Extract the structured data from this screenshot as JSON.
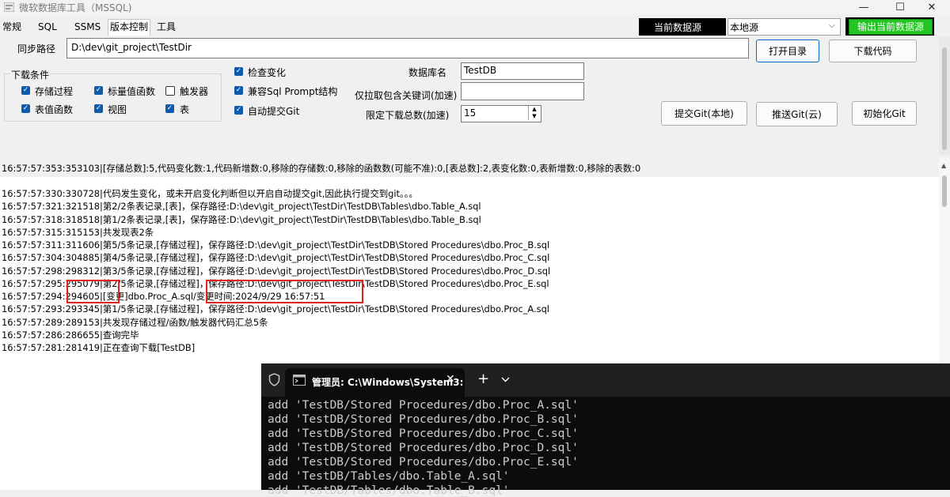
{
  "window": {
    "title": "微软数据库工具（MSSQL)",
    "minimize": "—",
    "maximize": "☐",
    "close": "✕"
  },
  "tabs": [
    "常规",
    "SQL",
    "SSMS",
    "版本控制",
    "工具"
  ],
  "datasource": {
    "label": "当前数据源",
    "selected": "本地源",
    "export_button": "输出当前数据源",
    "export_color": "#22c521"
  },
  "sync": {
    "path_label": "同步路径",
    "path_value": "D:\\dev\\git_project\\TestDir",
    "open_dir_button": "打开目录",
    "download_button": "下载代码"
  },
  "download_conditions": {
    "title": "下载条件",
    "items": [
      {
        "label": "存储过程",
        "checked": true
      },
      {
        "label": "标量值函数",
        "checked": true
      },
      {
        "label": "触发器",
        "checked": false
      },
      {
        "label": "表值函数",
        "checked": true
      },
      {
        "label": "视图",
        "checked": true
      },
      {
        "label": "表",
        "checked": true
      }
    ]
  },
  "options": [
    {
      "label": "检查变化",
      "checked": true
    },
    {
      "label": "兼容Sql Prompt结构",
      "checked": true
    },
    {
      "label": "自动提交Git",
      "checked": true
    }
  ],
  "db": {
    "name_label": "数据库名",
    "name_value": "TestDB",
    "keyword_label": "仅拉取包含关键词(加速)",
    "keyword_value": "",
    "limit_label": "限定下载总数(加速)",
    "limit_value": "15"
  },
  "git_buttons": {
    "commit_local": "提交Git(本地)",
    "push_cloud": "推送Git(云)",
    "init": "初始化Git"
  },
  "log": {
    "summary": "16:57:57:353:353103|[存储总数]:5,代码变化数:1,代码新增数:0,移除的存储数:0,移除的函数数(可能不准):0,[表总数]:2,表变化数:0,表新增数:0,移除的表数:0",
    "lines": [
      "16:57:57:330:330728|代码发生变化，或未开启变化判断但以开启自动提交git,因此执行提交到git。。。",
      "16:57:57:321:321518|第2/2条表记录,[表]，保存路径:D:\\dev\\git_project\\TestDir\\TestDB\\Tables\\dbo.Table_A.sql",
      "16:57:57:318:318518|第1/2条表记录,[表]，保存路径:D:\\dev\\git_project\\TestDir\\TestDB\\Tables\\dbo.Table_B.sql",
      "16:57:57:315:315153|共发现表2条",
      "16:57:57:311:311606|第5/5条记录,[存储过程]，保存路径:D:\\dev\\git_project\\TestDir\\TestDB\\Stored Procedures\\dbo.Proc_B.sql",
      "16:57:57:304:304885|第4/5条记录,[存储过程]，保存路径:D:\\dev\\git_project\\TestDir\\TestDB\\Stored Procedures\\dbo.Proc_C.sql",
      "16:57:57:298:298312|第3/5条记录,[存储过程]，保存路径:D:\\dev\\git_project\\TestDir\\TestDB\\Stored Procedures\\dbo.Proc_D.sql",
      "16:57:57:295:295079|第2/5条记录,[存储过程]，保存路径:D:\\dev\\git_project\\TestDir\\TestDB\\Stored Procedures\\dbo.Proc_E.sql",
      "16:57:57:294:294605|[变更]dbo.Proc_A.sql/变更时间:2024/9/29 16:57:51",
      "16:57:57:293:293345|第1/5条记录,[存储过程]，保存路径:D:\\dev\\git_project\\TestDir\\TestDB\\Stored Procedures\\dbo.Proc_A.sql",
      "16:57:57:289:289153|共发现存储过程/函数/触发器代码汇总5条",
      "16:57:57:286:286655|查询完毕",
      "16:57:57:281:281419|正在查询下载[TestDB]"
    ]
  },
  "terminal": {
    "tab_title": "管理员: C:\\Windows\\System3:",
    "new_tab": "+",
    "lines": [
      "add 'TestDB/Stored Procedures/dbo.Proc_A.sql'",
      "add 'TestDB/Stored Procedures/dbo.Proc_B.sql'",
      "add 'TestDB/Stored Procedures/dbo.Proc_C.sql'",
      "add 'TestDB/Stored Procedures/dbo.Proc_D.sql'",
      "add 'TestDB/Stored Procedures/dbo.Proc_E.sql'",
      "add 'TestDB/Tables/dbo.Table_A.sql'",
      "add 'TestDB/Tables/dbo.Table_B.sql'"
    ]
  }
}
